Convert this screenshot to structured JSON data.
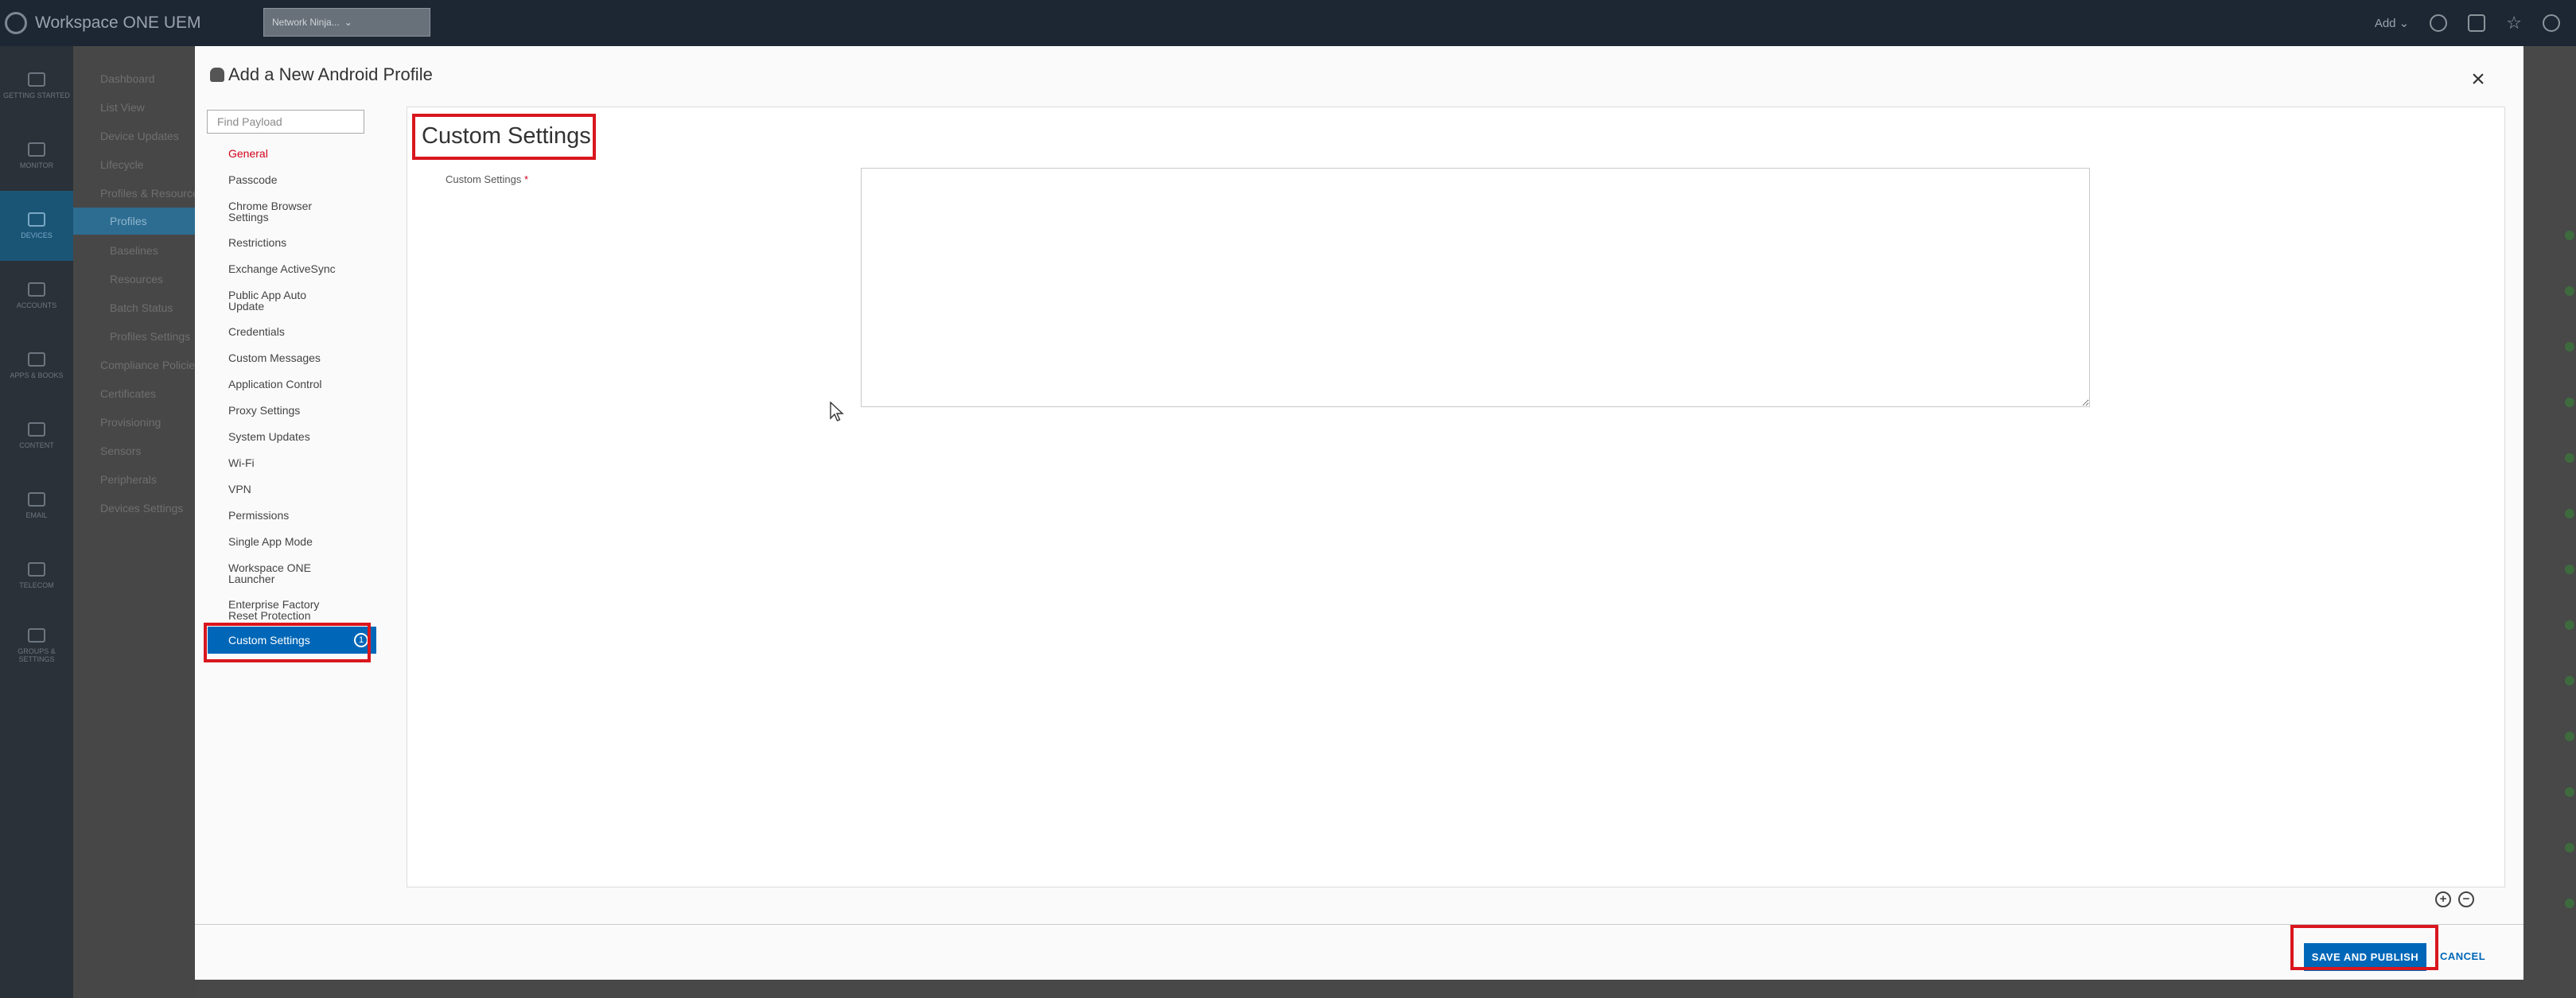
{
  "app": {
    "product_name": "Workspace ONE UEM",
    "org_selector": "Network Ninja..."
  },
  "top_bar": {
    "add_label": "Add",
    "icons": [
      "search-icon",
      "bell-icon",
      "star-icon",
      "help-icon"
    ]
  },
  "left_nav": {
    "items": [
      {
        "label": "GETTING STARTED",
        "icon": "rocket-icon"
      },
      {
        "label": "MONITOR",
        "icon": "monitor-icon"
      },
      {
        "label": "DEVICES",
        "icon": "device-icon",
        "active": true
      },
      {
        "label": "ACCOUNTS",
        "icon": "users-icon"
      },
      {
        "label": "APPS & BOOKS",
        "icon": "grid-icon"
      },
      {
        "label": "CONTENT",
        "icon": "file-icon"
      },
      {
        "label": "EMAIL",
        "icon": "mail-icon"
      },
      {
        "label": "TELECOM",
        "icon": "phone-icon"
      },
      {
        "label": "GROUPS & SETTINGS",
        "icon": "gear-icon"
      }
    ]
  },
  "sub_nav": {
    "items": [
      "Dashboard",
      "List View",
      "Device Updates",
      "Lifecycle",
      "Profiles & Resources",
      "Profiles",
      "Baselines",
      "Resources",
      "Batch Status",
      "Profiles Settings",
      "Compliance Policies",
      "Certificates",
      "Provisioning",
      "Sensors",
      "Peripherals",
      "Devices Settings"
    ]
  },
  "modal": {
    "title": "Add a New Android Profile",
    "close_label": "×",
    "search": {
      "placeholder": "Find Payload",
      "value": ""
    },
    "payloads": [
      {
        "label": "General",
        "state": "error"
      },
      {
        "label": "Passcode"
      },
      {
        "label": "Chrome Browser Settings"
      },
      {
        "label": "Restrictions"
      },
      {
        "label": "Exchange ActiveSync"
      },
      {
        "label": "Public App Auto Update"
      },
      {
        "label": "Credentials"
      },
      {
        "label": "Custom Messages"
      },
      {
        "label": "Application Control"
      },
      {
        "label": "Proxy Settings"
      },
      {
        "label": "System Updates"
      },
      {
        "label": "Wi-Fi"
      },
      {
        "label": "VPN"
      },
      {
        "label": "Permissions"
      },
      {
        "label": "Single App Mode"
      },
      {
        "label": "Workspace ONE Launcher"
      },
      {
        "label": "Enterprise Factory Reset Protection"
      },
      {
        "label": "Custom Settings",
        "state": "active",
        "badge": "1"
      }
    ],
    "panel": {
      "heading": "Custom Settings",
      "field_label": "Custom Settings",
      "required_mark": "*",
      "textarea_value": ""
    },
    "zoom": {
      "plus": "+",
      "minus": "−"
    },
    "footer": {
      "save_label": "SAVE AND PUBLISH",
      "cancel_label": "CANCEL"
    }
  },
  "colors": {
    "primary": "#0067b8",
    "error": "#d0021b",
    "highlight": "#d9161e",
    "topbar": "#1d2733"
  }
}
